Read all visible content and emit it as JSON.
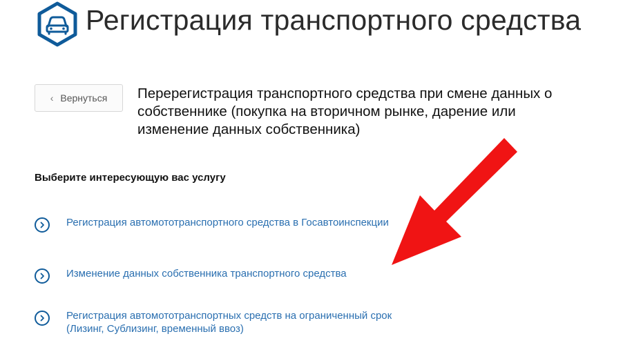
{
  "header": {
    "title": "Регистрация транспортного средства",
    "icon": "car-hexagon-icon"
  },
  "back_button": {
    "label": "Вернуться",
    "icon": "chevron-left-icon"
  },
  "service": {
    "title": "Перерегистрация транспортного средства при смене данных о собственнике (покупка на вторичном рынке, дарение или изменение данных собственника)"
  },
  "services_section": {
    "heading": "Выберите интересующую вас услугу",
    "options": [
      {
        "label": "Регистрация автомототранспортного средства в Госавтоинспекции",
        "icon": "chevron-right-circle-icon"
      },
      {
        "label": "Изменение данных собственника транспортного средства",
        "icon": "chevron-right-circle-icon"
      },
      {
        "label": "Регистрация автомототранспортных средств на ограниченный срок (Лизинг, Сублизинг, временный ввоз)",
        "icon": "chevron-right-circle-icon"
      }
    ]
  },
  "colors": {
    "brand_blue": "#0f5b9a",
    "link_blue": "#2a6fb0",
    "annotation_red": "#f01414"
  }
}
